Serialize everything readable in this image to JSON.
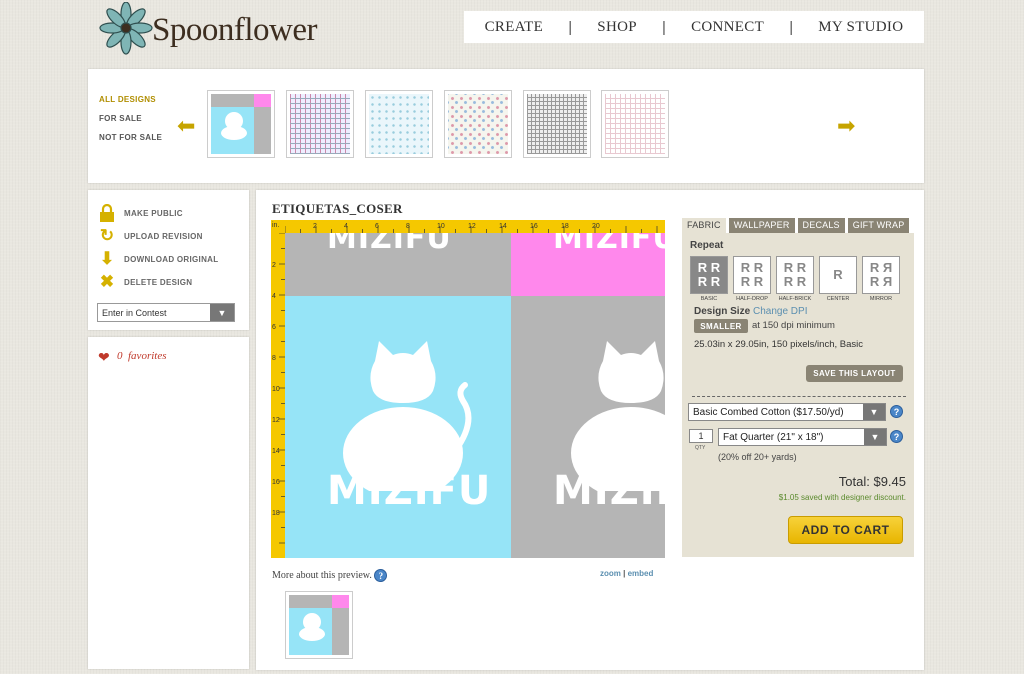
{
  "header": {
    "logo_text": "Spoonflower",
    "nav": [
      "CREATE",
      "SHOP",
      "CONNECT",
      "MY STUDIO"
    ]
  },
  "carousel": {
    "filters": [
      "ALL DESIGNS",
      "FOR SALE",
      "NOT FOR SALE"
    ],
    "active_filter": "ALL DESIGNS",
    "thumb_count": 6
  },
  "actions": {
    "items": [
      {
        "label": "MAKE PUBLIC",
        "icon": "lock-icon"
      },
      {
        "label": "UPLOAD REVISION",
        "icon": "refresh-icon"
      },
      {
        "label": "DOWNLOAD ORIGINAL",
        "icon": "download-arrow-icon"
      },
      {
        "label": "DELETE DESIGN",
        "icon": "x-icon"
      }
    ],
    "contest_select": "Enter in Contest"
  },
  "favorites": {
    "count": "0",
    "label": "favorites"
  },
  "design": {
    "title": "ETIQUETAS_COSER",
    "ruler_unit": "in.",
    "ruler_top": [
      "2",
      "4",
      "6",
      "8",
      "10",
      "12",
      "14",
      "16",
      "18",
      "20"
    ],
    "ruler_left": [
      "2",
      "4",
      "6",
      "8",
      "10",
      "12",
      "14",
      "16",
      "18"
    ],
    "tile_text": "MIZIFU",
    "more_text": "More about this preview.",
    "zoom_label": "zoom",
    "embed_label": "embed",
    "colors": {
      "cyan": "#96e4f7",
      "gray": "#b5b5b5",
      "pink": "#ff88ec",
      "white": "#ffffff",
      "ruler": "#f5c800"
    }
  },
  "options": {
    "tabs": [
      "FABRIC",
      "WALLPAPER",
      "DECALS",
      "GIFT WRAP"
    ],
    "active_tab": "FABRIC",
    "repeat_label": "Repeat",
    "repeats": [
      "BASIC",
      "HALF-DROP",
      "HALF-BRICK",
      "CENTER",
      "MIRROR"
    ],
    "active_repeat": "BASIC",
    "design_size_label": "Design Size",
    "change_dpi": "Change DPI",
    "smaller_label": "SMALLER",
    "dpi_text": "at 150 dpi minimum",
    "dimensions": "25.03in x 29.05in, 150 pixels/inch, Basic",
    "save_layout": "SAVE THIS LAYOUT",
    "fabric_select": "Basic Combed Cotton ($17.50/yd)",
    "qty": "1",
    "qty_label": "QTY",
    "size_select": "Fat Quarter (21\" x 18\")",
    "discount_note": "(20% off 20+ yards)",
    "total": "Total: $9.45",
    "saved": "$1.05 saved with designer discount.",
    "add_to_cart": "ADD TO CART"
  }
}
